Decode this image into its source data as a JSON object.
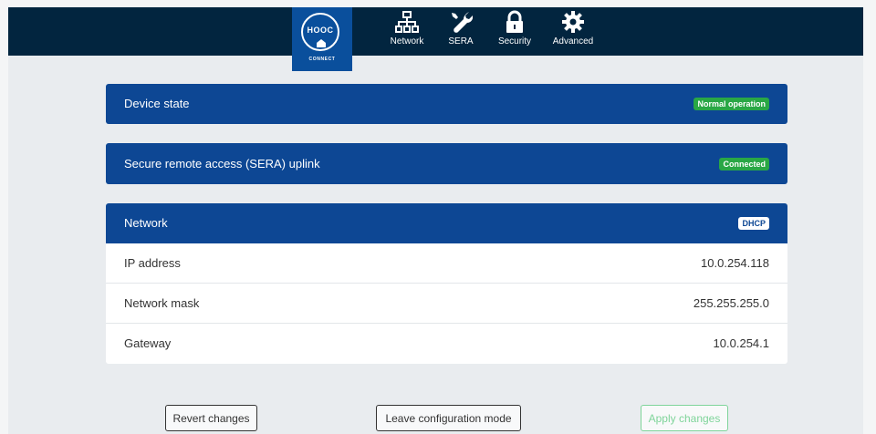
{
  "brand": {
    "logo_text": "HOOC",
    "logo_subtext": "CONNECT"
  },
  "nav": {
    "items": [
      {
        "label": "Network",
        "icon": "network-icon"
      },
      {
        "label": "SERA",
        "icon": "wrench-icon"
      },
      {
        "label": "Security",
        "icon": "lock-icon"
      },
      {
        "label": "Advanced",
        "icon": "gear-icon"
      }
    ]
  },
  "device_state": {
    "title": "Device state",
    "badge": "Normal operation"
  },
  "sera": {
    "title": "Secure remote access (SERA) uplink",
    "badge": "Connected"
  },
  "network": {
    "title": "Network",
    "badge": "DHCP",
    "rows": [
      {
        "label": "IP address",
        "value": "10.0.254.118"
      },
      {
        "label": "Network mask",
        "value": "255.255.255.0"
      },
      {
        "label": "Gateway",
        "value": "10.0.254.1"
      }
    ]
  },
  "actions": {
    "revert_label": "Revert changes",
    "leave_label": "Leave configuration mode",
    "apply_label": "Apply changes"
  },
  "colors": {
    "topbar": "#02253f",
    "card_header": "#0d4794",
    "badge_green": "#29a745",
    "apply_accent": "#7fd49a"
  }
}
